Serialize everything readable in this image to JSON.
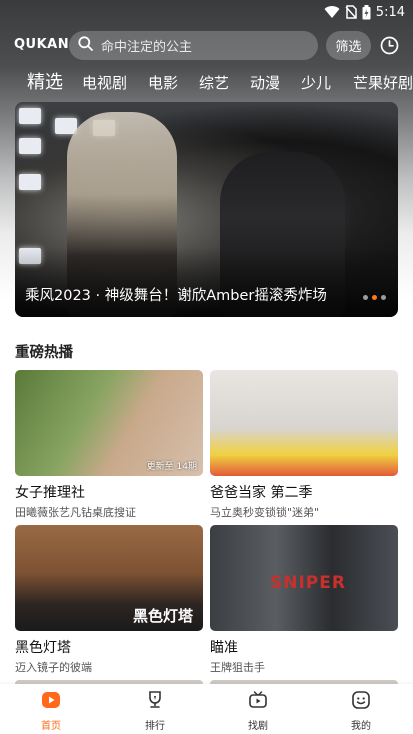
{
  "status_bar": {
    "time": "5:14"
  },
  "header": {
    "logo": "QUKAN",
    "search_placeholder": "命中注定的公主",
    "filter_label": "筛选"
  },
  "tabs": [
    {
      "label": "精选",
      "active": true
    },
    {
      "label": "电视剧",
      "active": false
    },
    {
      "label": "电影",
      "active": false
    },
    {
      "label": "综艺",
      "active": false
    },
    {
      "label": "动漫",
      "active": false
    },
    {
      "label": "少儿",
      "active": false
    },
    {
      "label": "芒果好剧",
      "active": false
    }
  ],
  "banner": {
    "title": "乘风2023 · 神级舞台！谢欣Amber摇滚秀炸场",
    "page_count": 3,
    "active_index": 1
  },
  "section": {
    "title": "重磅热播",
    "cards": [
      {
        "name": "女子推理社",
        "desc": "田曦薇张艺凡钻桌底搜证",
        "badge": "更新至 14期"
      },
      {
        "name": "爸爸当家 第二季",
        "desc": "马立奥秒变锁锁\"迷弟\"",
        "badge": ""
      },
      {
        "name": "黑色灯塔",
        "desc": "迈入镜子的彼端",
        "badge": "",
        "overlay": "黑色灯塔"
      },
      {
        "name": "瞄准",
        "desc": "王牌狙击手",
        "badge": "",
        "overlay": "SNIPER"
      }
    ]
  },
  "bottom_nav": [
    {
      "label": "首页",
      "icon": "home-play-icon",
      "active": true
    },
    {
      "label": "排行",
      "icon": "trophy-icon",
      "active": false
    },
    {
      "label": "找剧",
      "icon": "tv-icon",
      "active": false
    },
    {
      "label": "我的",
      "icon": "smiley-face-icon",
      "active": false
    }
  ],
  "colors": {
    "accent": "#ff6a1a",
    "dot_active": "#ff7a1a"
  }
}
